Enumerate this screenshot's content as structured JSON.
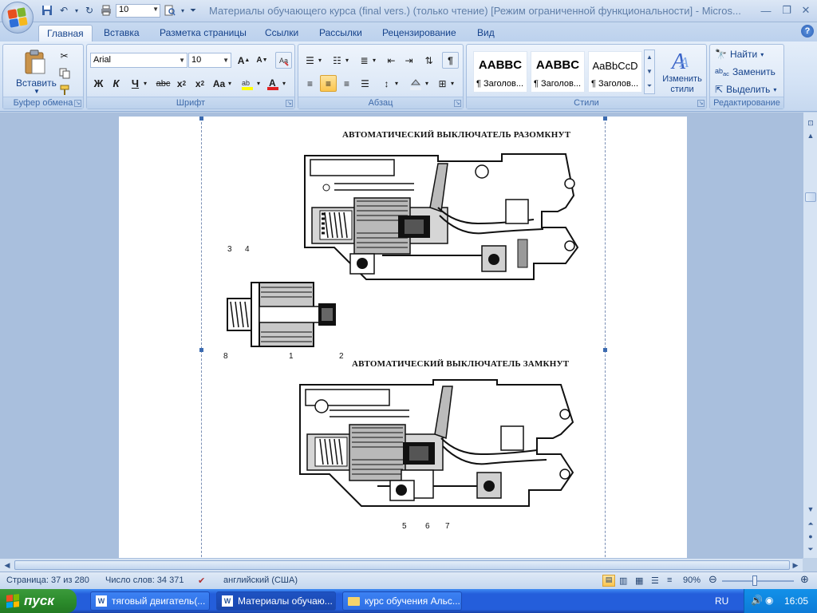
{
  "window": {
    "title": "Материалы обучающего курса (final vers.) (только чтение) [Режим ограниченной функциональности] - Micros...",
    "zoom_field": "10"
  },
  "tabs": [
    "Главная",
    "Вставка",
    "Разметка страницы",
    "Ссылки",
    "Рассылки",
    "Рецензирование",
    "Вид"
  ],
  "ribbon": {
    "clipboard": {
      "label": "Буфер обмена",
      "paste": "Вставить"
    },
    "font": {
      "label": "Шрифт",
      "family": "Arial",
      "size": "10"
    },
    "paragraph": {
      "label": "Абзац"
    },
    "styles": {
      "label": "Стили",
      "items": [
        {
          "sample": "AABBC",
          "name": "¶ Заголов..."
        },
        {
          "sample": "AABBC",
          "name": "¶ Заголов..."
        },
        {
          "sample": "AaBbCcD",
          "name": "¶ Заголов..."
        }
      ],
      "change_styles": "Изменить стили"
    },
    "editing": {
      "label": "Редактирование",
      "find": "Найти",
      "replace": "Заменить",
      "select": "Выделить"
    }
  },
  "document": {
    "heading_open": "АВТОМАТИЧЕСКИЙ ВЫКЛЮЧАТЕЛЬ РАЗОМКНУТ",
    "heading_closed": "АВТОМАТИЧЕСКИЙ ВЫКЛЮЧАТЕЛЬ ЗАМКНУТ",
    "callouts": [
      "3",
      "4",
      "8",
      "1",
      "2",
      "5",
      "6",
      "7"
    ]
  },
  "statusbar": {
    "page": "Страница: 37 из 280",
    "words": "Число слов: 34 371",
    "language": "английский (США)",
    "zoom": "90%"
  },
  "taskbar": {
    "start": "пуск",
    "tasks": [
      "тяговый двигатель(...",
      "Материалы обучаю...",
      "курс обучения Альс..."
    ],
    "lang": "RU",
    "clock": "16:05"
  }
}
